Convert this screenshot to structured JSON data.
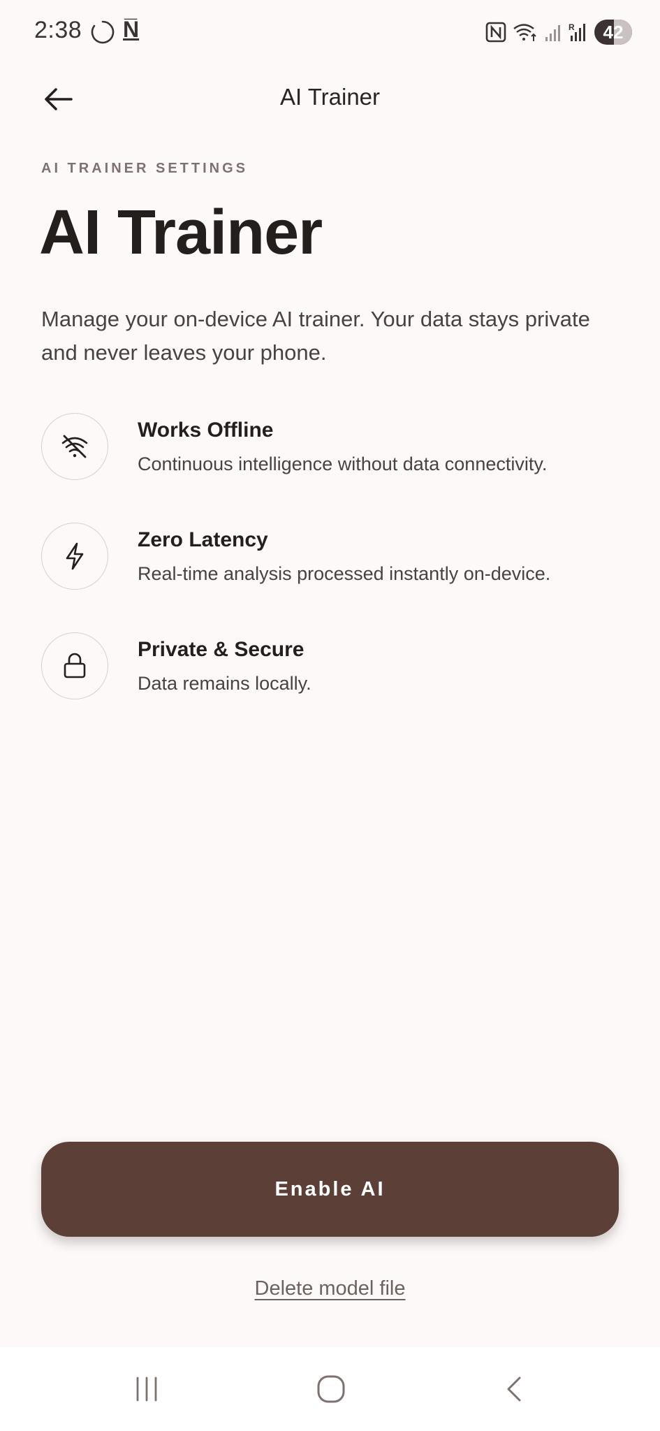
{
  "status_bar": {
    "time": "2:38",
    "note_glyph": "N̅",
    "battery": "42",
    "icons": [
      "sync-icon",
      "notification-n-icon",
      "nfc-icon",
      "wifi-icon",
      "signal-icon",
      "signal-r-icon",
      "battery-icon"
    ]
  },
  "app_bar": {
    "title": "AI Trainer",
    "back_icon": "arrow-left-icon"
  },
  "content": {
    "overline": "AI TRAINER SETTINGS",
    "headline": "AI Trainer",
    "description": "Manage your on-device AI trainer. Your data stays private and never leaves your phone.",
    "features": [
      {
        "icon": "wifi-off-icon",
        "title": "Works Offline",
        "description": "Continuous intelligence without data connectivity."
      },
      {
        "icon": "bolt-icon",
        "title": "Zero Latency",
        "description": "Real-time analysis processed instantly on-device."
      },
      {
        "icon": "lock-icon",
        "title": "Private & Secure",
        "description": "Data remains locally."
      }
    ]
  },
  "actions": {
    "enable_label": "Enable AI",
    "delete_label": "Delete model file"
  },
  "nav_bar": {
    "icons": [
      "recents-icon",
      "home-icon",
      "back-icon"
    ]
  },
  "colors": {
    "background": "#FCF9F8",
    "primary_button": "#5C4038",
    "text_primary": "#241E1D",
    "text_secondary": "#4A4240",
    "overline": "#7E7270"
  }
}
